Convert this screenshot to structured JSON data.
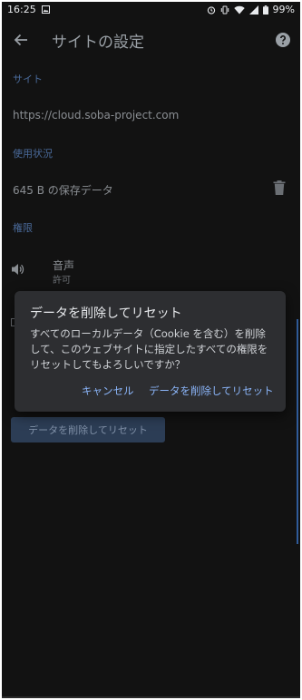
{
  "status_bar": {
    "time": "16:25",
    "battery": "99%",
    "icons": [
      "image-icon",
      "alarm-icon",
      "vibrate-icon",
      "wifi-icon",
      "signal-icon",
      "battery-icon"
    ]
  },
  "app_bar": {
    "title": "サイトの設定",
    "back_icon": "arrow-left-icon",
    "help_icon": "help-circle-icon"
  },
  "site_section": {
    "label": "サイト",
    "url": "https://cloud.soba-project.com"
  },
  "usage_section": {
    "label": "使用状況",
    "storage": "645 B の保存データ",
    "delete_icon": "trash-icon"
  },
  "permissions_section": {
    "label": "権限",
    "sound": {
      "title": "音声",
      "value": "許可",
      "icon": "speaker-icon"
    }
  },
  "reset_button_label": "データを削除してリセット",
  "dialog": {
    "title": "データを削除してリセット",
    "body": "すべてのローカルデータ（Cookie を含む）を削除して、このウェブサイトに指定したすべての権限をリセットしてもよろしいですか？",
    "cancel_label": "キャンセル",
    "confirm_label": "データを削除してリセット"
  },
  "colors": {
    "background": "#121212",
    "dialog": "#2d2e31",
    "accent": "#8ab4f8",
    "section_label": "#4a6a9a"
  }
}
